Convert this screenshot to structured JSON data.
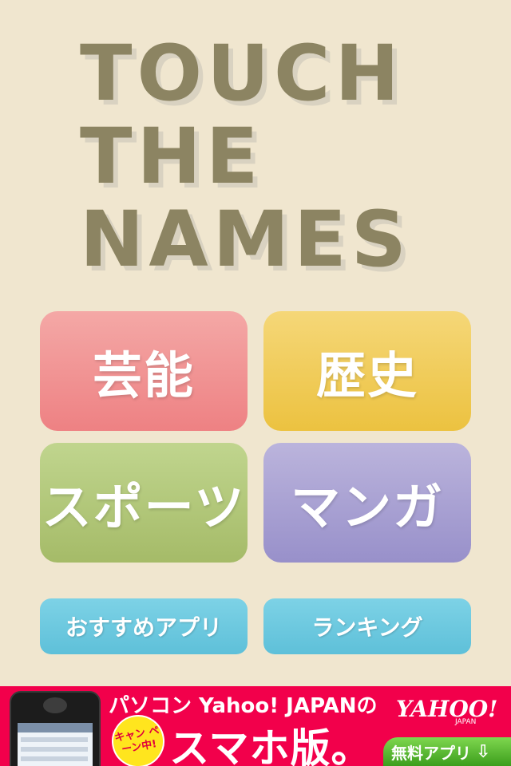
{
  "title": {
    "line1": "TOUCH",
    "line2": "THE",
    "line3": "NAMES"
  },
  "categories": {
    "geino": "芸能",
    "rekishi": "歴史",
    "sports": "スポーツ",
    "manga": "マンガ"
  },
  "menu": {
    "osusume": "おすすめアプリ",
    "ranking": "ランキング"
  },
  "ad": {
    "headline": "パソコン Yahoo! JAPANの",
    "badge": "キャン ペーン中!",
    "main": "スマホ版。",
    "brand": "YAHOO!",
    "brand_sub": "JAPAN",
    "download": "無料アプリ",
    "download_icon": "download-icon"
  },
  "colors": {
    "background": "#f0e6cf",
    "title": "#8c8462",
    "geino": "#ee8183",
    "rekishi": "#ecc240",
    "sports": "#a5bb68",
    "manga": "#9890ca",
    "menu": "#5ec0d9",
    "ad": "#f2004b"
  }
}
